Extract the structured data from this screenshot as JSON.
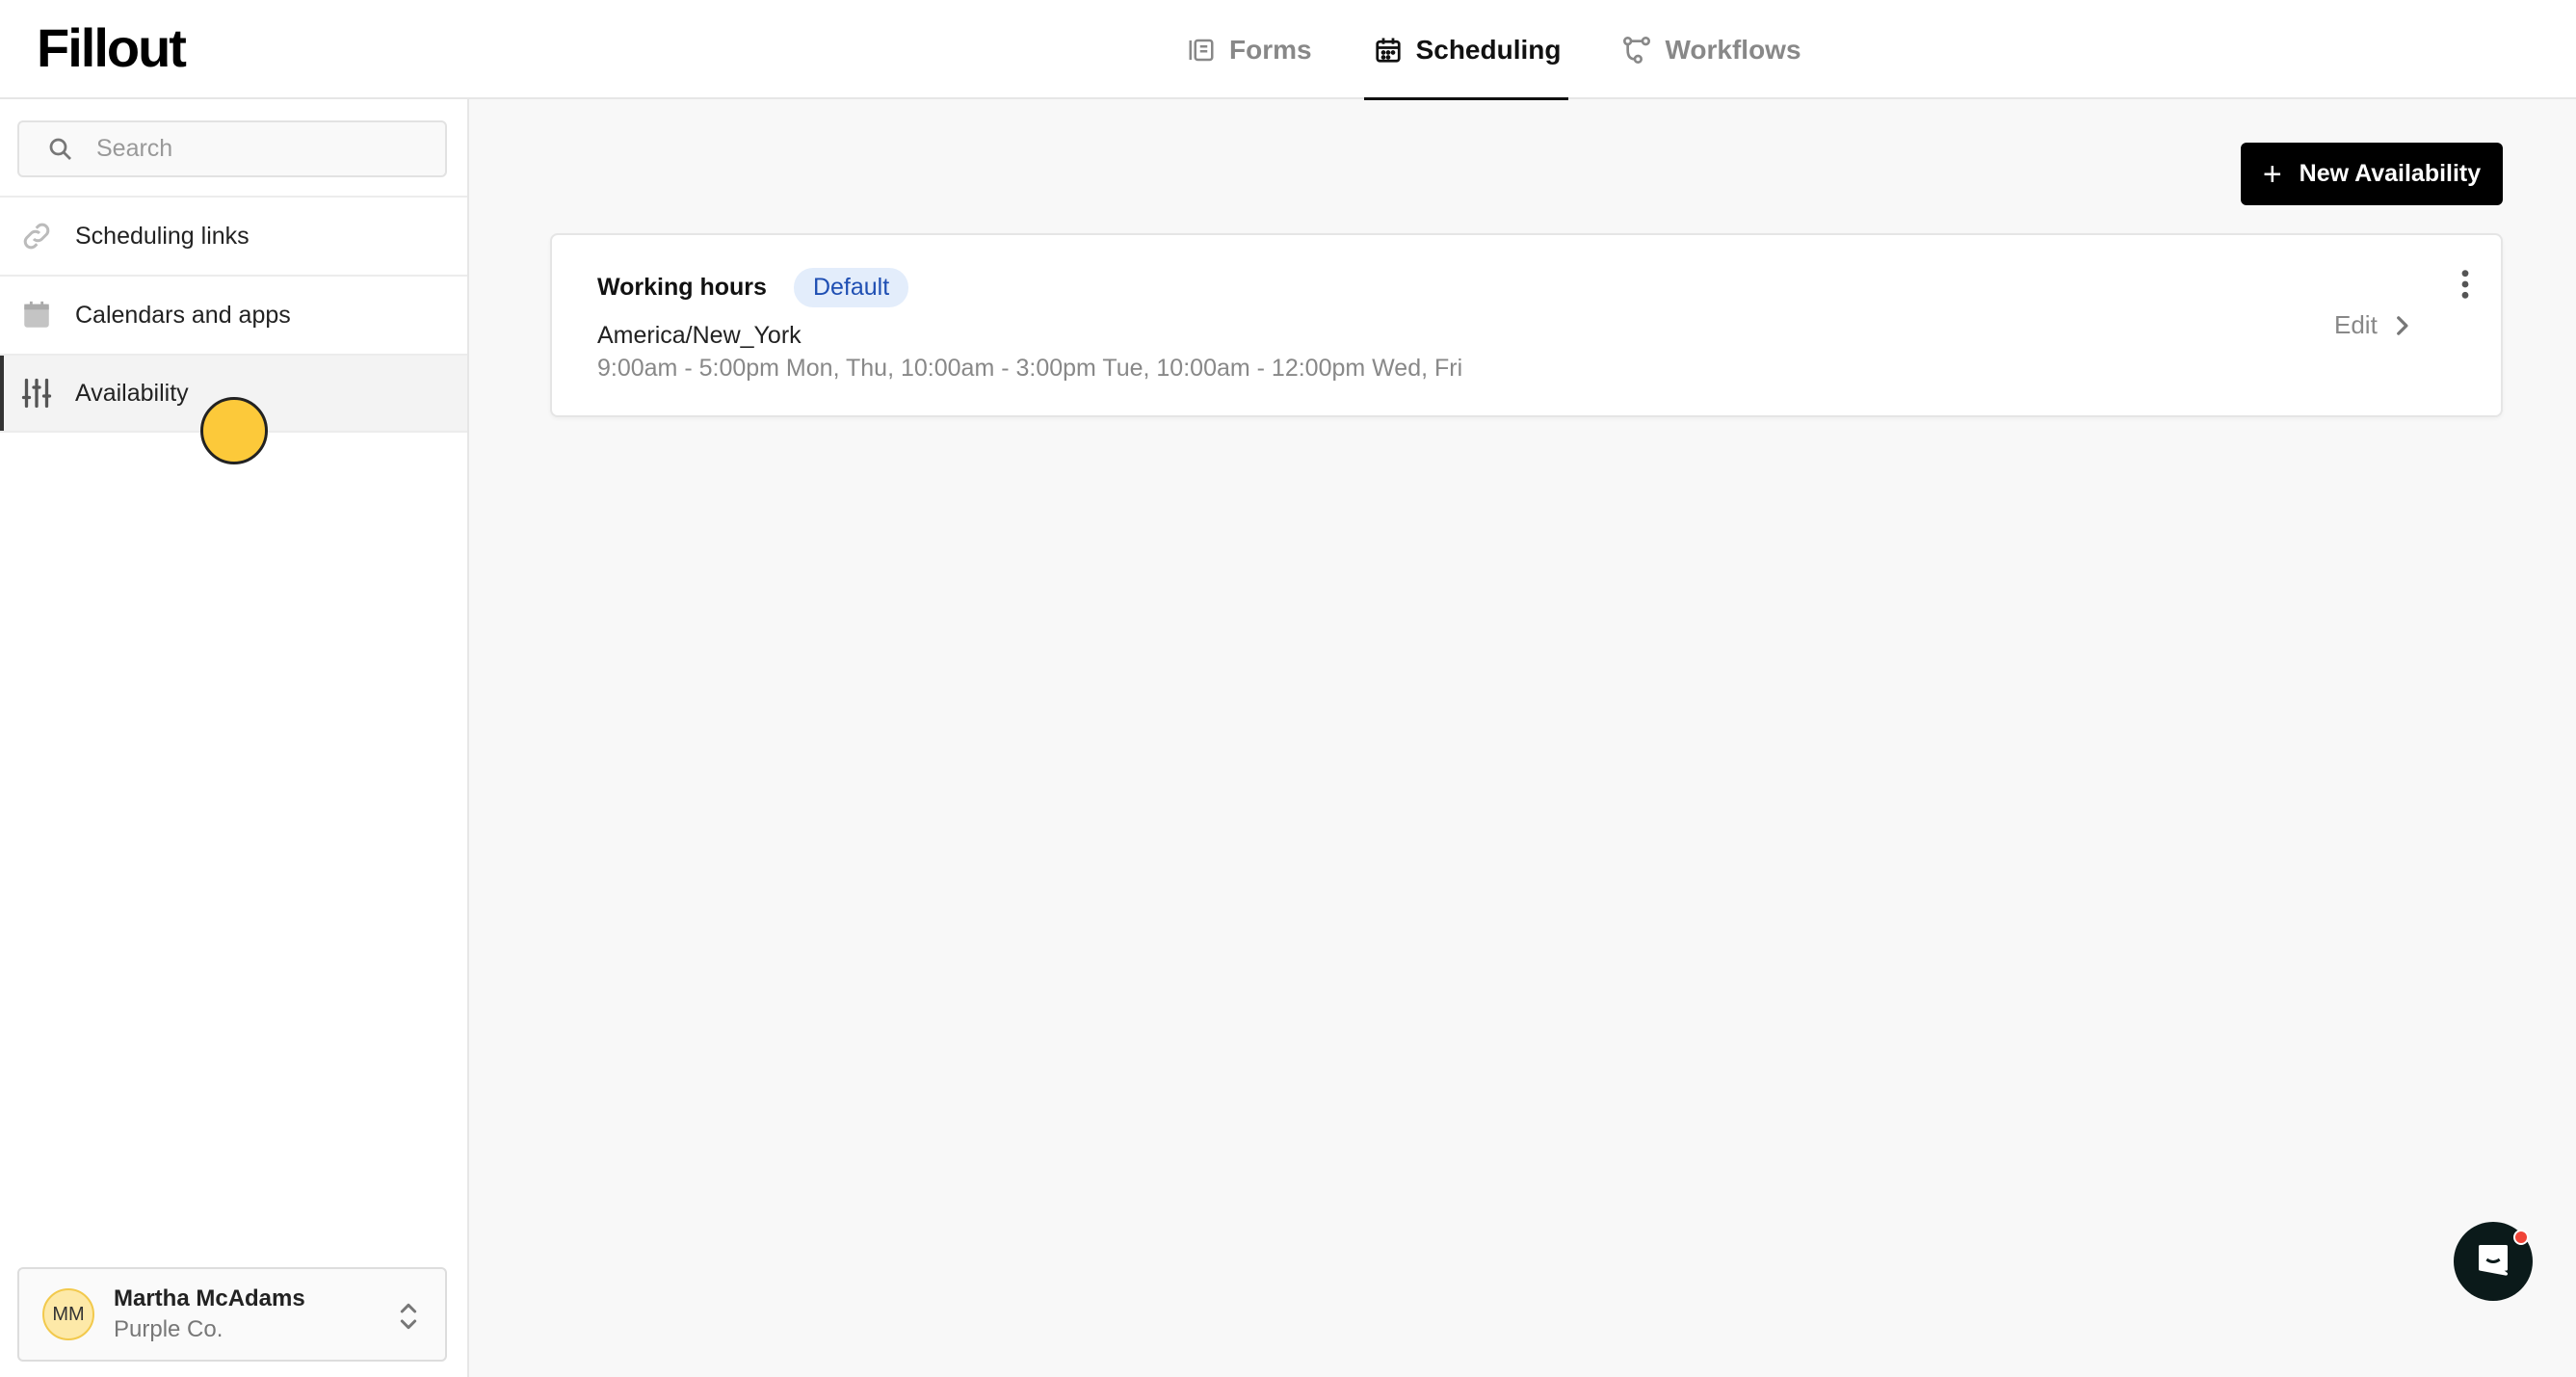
{
  "app": {
    "logo": "Fillout"
  },
  "header": {
    "tabs": [
      {
        "label": "Forms",
        "icon": "forms-icon",
        "active": false
      },
      {
        "label": "Scheduling",
        "icon": "calendar-icon",
        "active": true
      },
      {
        "label": "Workflows",
        "icon": "workflow-icon",
        "active": false
      }
    ]
  },
  "sidebar": {
    "search": {
      "placeholder": "Search",
      "value": ""
    },
    "items": [
      {
        "label": "Scheduling links",
        "icon": "link-icon"
      },
      {
        "label": "Calendars and apps",
        "icon": "calendar-icon"
      },
      {
        "label": "Availability",
        "icon": "sliders-icon",
        "active": true
      }
    ],
    "user": {
      "initials": "MM",
      "name": "Martha McAdams",
      "org": "Purple Co."
    }
  },
  "main": {
    "new_button": {
      "label": "New Availability"
    },
    "availabilities": [
      {
        "title": "Working hours",
        "badge": "Default",
        "timezone": "America/New_York",
        "hours": "9:00am - 5:00pm Mon, Thu, 10:00am - 3:00pm Tue, 10:00am - 12:00pm Wed, Fri",
        "edit_label": "Edit"
      }
    ]
  },
  "colors": {
    "accent": "#000000",
    "badge_bg": "#e3edfb",
    "badge_text": "#1f4fb3",
    "cursor": "#fcc93a"
  }
}
